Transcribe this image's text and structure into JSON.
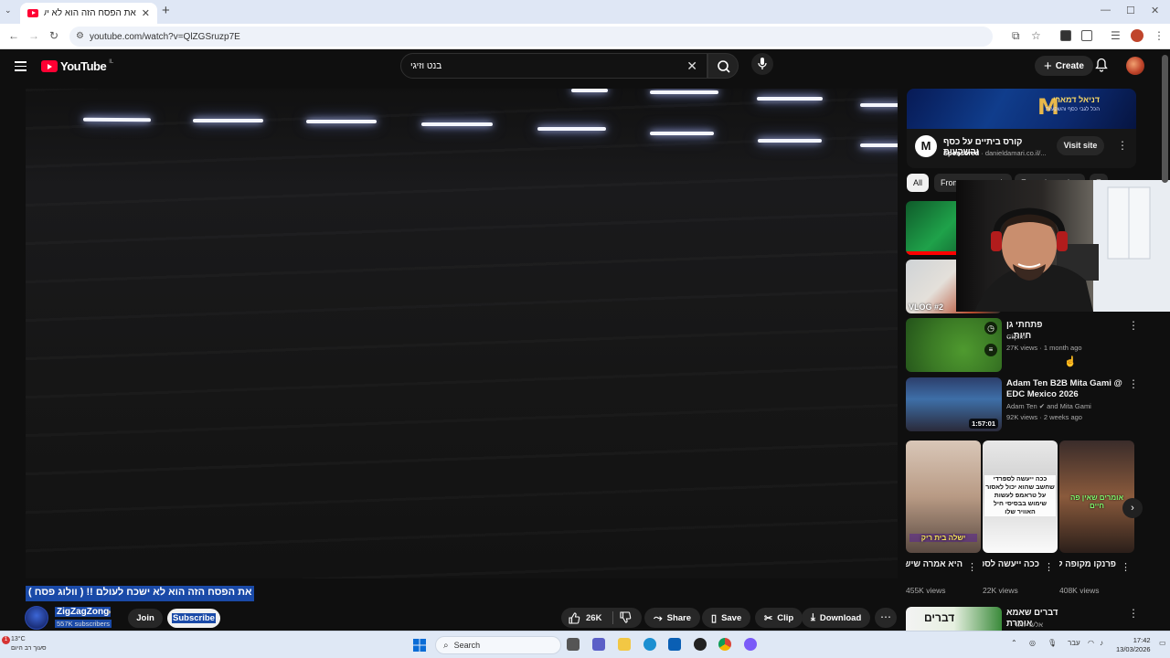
{
  "browser": {
    "tab_title": "את הפסח הזה הוא לא ישכח לע...",
    "tab_close": "✕",
    "new_tab": "+",
    "url": "youtube.com/watch?v=QlZGSruzp7E",
    "win_min": "—",
    "win_max": "☐",
    "win_close": "✕"
  },
  "youtube": {
    "logo_text": "YouTube",
    "country_code": "IL",
    "search_query": "בנט וזיגי",
    "create_label": "Create"
  },
  "video": {
    "title": "את הפסח הזה הוא לא ישכח לעולם !! ( וולוג פסח )",
    "channel_name": "ZigZagZong",
    "subscribers": "557K subscribers",
    "join_label": "Join",
    "subscribe_label": "Subscribe",
    "likes": "26K",
    "share_label": "Share",
    "save_label": "Save",
    "clip_label": "Clip",
    "download_label": "Download"
  },
  "ad": {
    "banner_title": "דניאל דמארי",
    "banner_sub": "הכל לגבי כסף והשקעות",
    "title": "קורס ביתיים על כסף והשקעות",
    "sponsored": "Sponsored",
    "domain": "danieldamari.co.il/...",
    "visit_label": "Visit site"
  },
  "chips": [
    "All",
    "From your search",
    "From the series",
    "F"
  ],
  "related": [
    {
      "title": "",
      "meta1": "",
      "meta2": "",
      "thumb_label": ""
    },
    {
      "title": "",
      "meta1": "",
      "meta2": "",
      "thumb_label": "VLOG #2"
    },
    {
      "title": "פתחתי גן חיות...",
      "meta1": "Clipim",
      "meta2": "27K views · 1 month ago",
      "duration": ""
    },
    {
      "title": "Adam Ten B2B Mita Gami @ EDC Mexico 2026",
      "meta1": "Adam Ten ✔ and Mita Gami",
      "meta2": "92K views · 2 weeks ago",
      "duration": "1:57:01"
    }
  ],
  "shorts": [
    {
      "title": "היא אמרה שיש לה בית ריק ...",
      "views": "455K views",
      "overlay": "ישלה בית ריק"
    },
    {
      "title": "ככה ייעשה לספרדי שחשב...",
      "views": "22K views",
      "overlay": "ככה ייעשה לספרדי שחשב שהוא יכול לאסור על טראמפ לעשות שימוש בבסיסי חיל האוויר שלו"
    },
    {
      "title": "פרנקו מקופה לראשית בראשית...",
      "views": "408K views",
      "overlay": "אומרים שאין פה חיים"
    }
  ],
  "next_related": {
    "title": "דברים שאמא אומרת",
    "meta1": "אלעד הלוי",
    "thumb_label": "דברים"
  },
  "taskbar": {
    "temperature": "13°C",
    "weather_text": "סעוך רב היום",
    "search_label": "Search",
    "lang": "עבר",
    "time": "17:42",
    "date": "13/03/2026"
  },
  "colors": {
    "accent": "#ff0033",
    "selection": "#1a4aa8",
    "bg": "#0f0f0f"
  }
}
